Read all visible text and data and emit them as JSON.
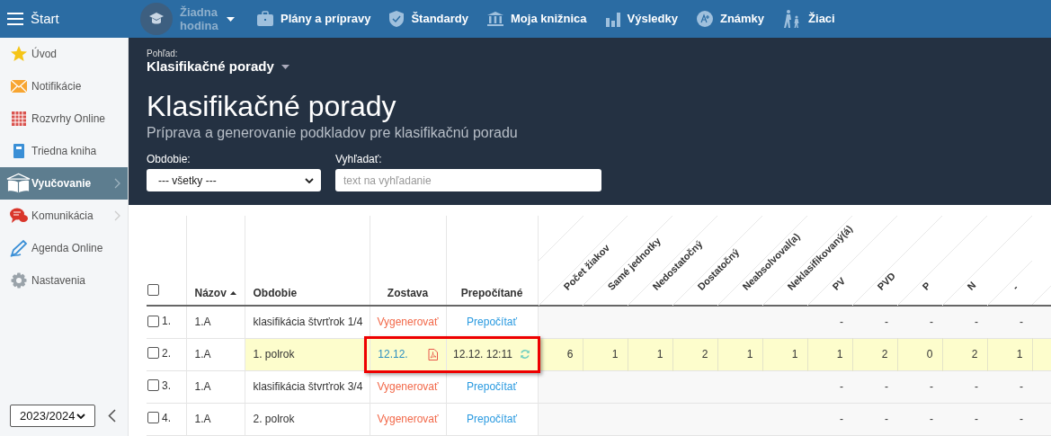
{
  "topbar": {
    "start_label": "Štart",
    "lesson": "Žiadna hodina",
    "menu": [
      {
        "label": "Plány a prípravy"
      },
      {
        "label": "Štandardy"
      },
      {
        "label": "Moja knižnica"
      },
      {
        "label": "Výsledky"
      },
      {
        "label": "Známky"
      },
      {
        "label": "Žiaci"
      }
    ]
  },
  "sidebar": {
    "items": [
      {
        "label": "Úvod",
        "selected": false,
        "submenu": false
      },
      {
        "label": "Notifikácie",
        "selected": false,
        "submenu": false
      },
      {
        "label": "Rozvrhy Online",
        "selected": false,
        "submenu": false
      },
      {
        "label": "Triedna kniha",
        "selected": false,
        "submenu": false
      },
      {
        "label": "Vyučovanie",
        "selected": true,
        "submenu": true
      },
      {
        "label": "Komunikácia",
        "selected": false,
        "submenu": true
      },
      {
        "label": "Agenda Online",
        "selected": false,
        "submenu": false
      },
      {
        "label": "Nastavenia",
        "selected": false,
        "submenu": false
      }
    ],
    "year": "2023/2024"
  },
  "view": {
    "label": "Pohľad:",
    "value": "Klasifikačné porady"
  },
  "title": "Klasifikačné porady",
  "subtitle": "Príprava a generovanie podkladov pre klasifikačnú poradu",
  "filters": [
    {
      "kind": "select",
      "label": "Obdobie:",
      "value": "--- všetky ---"
    },
    {
      "kind": "input",
      "label": "Vyhľadať:",
      "placeholder": "text na vyhľadanie"
    }
  ],
  "table": {
    "select_all_checked": false,
    "columns": [
      {
        "label": "Názov",
        "sorted": true
      },
      {
        "label": "Obdobie",
        "sorted": false
      },
      {
        "label": "Zostava",
        "sorted": false
      },
      {
        "label": "Prepočítané",
        "sorted": false
      }
    ],
    "stat_columns": [
      "Počet žiakov",
      "Samé jednotky",
      "Nedostatočný",
      "Dostatočný",
      "Neabsolvoval(a)",
      "Neklasifikovaný(á)",
      "PV",
      "PVD",
      "P",
      "N",
      "-"
    ],
    "rows": [
      {
        "number": "1.",
        "checked": false,
        "name": "1.A",
        "period": "klasifikácia štvrťrok 1/4",
        "highlighted": false,
        "framed": false,
        "report": {
          "kind": "action",
          "text": "Vygenerovať"
        },
        "recalc": {
          "kind": "action",
          "text": "Prepočítať"
        },
        "stats": [
          "-",
          "-",
          "-",
          "-",
          "-"
        ]
      },
      {
        "number": "2.",
        "checked": false,
        "name": "1.A",
        "period": "1. polrok",
        "highlighted": true,
        "framed": true,
        "report": {
          "kind": "date",
          "text": "12.12."
        },
        "recalc": {
          "kind": "date",
          "text": "12.12. 12:11"
        },
        "stats": [
          "6",
          "1",
          "1",
          "2",
          "1",
          "1",
          "1",
          "2",
          "0",
          "2",
          "1"
        ]
      },
      {
        "number": "3.",
        "checked": false,
        "name": "1.A",
        "period": "klasifikácia štvrťrok 3/4",
        "highlighted": false,
        "framed": false,
        "report": {
          "kind": "action",
          "text": "Vygenerovať"
        },
        "recalc": {
          "kind": "action",
          "text": "Prepočítať"
        },
        "stats": [
          "-",
          "-",
          "-",
          "-",
          "-"
        ]
      },
      {
        "number": "4.",
        "checked": false,
        "name": "1.A",
        "period": "2. polrok",
        "highlighted": false,
        "framed": false,
        "report": {
          "kind": "action",
          "text": "Vygenerovať"
        },
        "recalc": {
          "kind": "action",
          "text": "Prepočítať"
        },
        "stats": [
          "-",
          "-",
          "-",
          "-",
          "-"
        ]
      }
    ]
  }
}
